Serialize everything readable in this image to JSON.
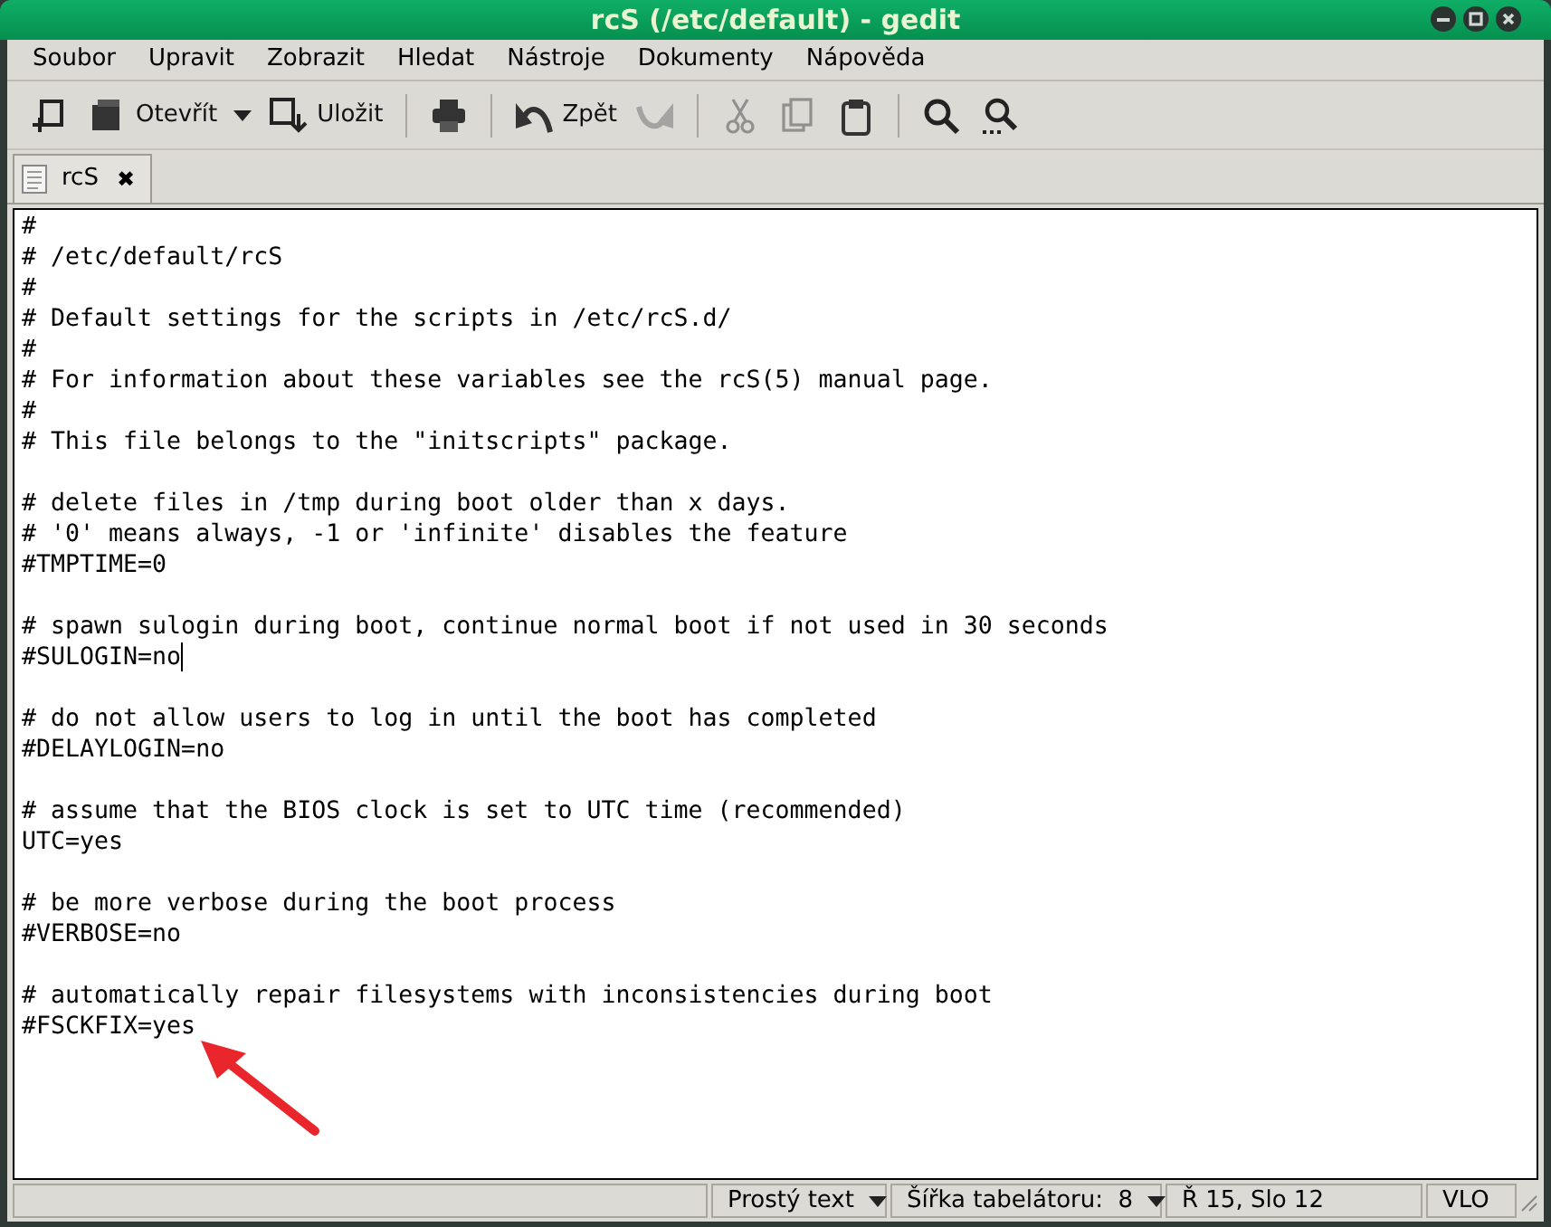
{
  "window": {
    "title": "rcS (/etc/default) - gedit"
  },
  "menu": [
    "Soubor",
    "Upravit",
    "Zobrazit",
    "Hledat",
    "Nástroje",
    "Dokumenty",
    "Nápověda"
  ],
  "toolbar": [
    {
      "kind": "button",
      "disabled": false
    },
    {
      "kind": "button",
      "label": "Otevřít",
      "disabled": false
    },
    {
      "kind": "dropdown",
      "disabled": false
    },
    {
      "kind": "button",
      "label": "Uložit",
      "disabled": false
    },
    {
      "kind": "separator"
    },
    {
      "kind": "button",
      "disabled": false
    },
    {
      "kind": "separator"
    },
    {
      "kind": "button",
      "label": "Zpět",
      "disabled": false
    },
    {
      "kind": "button",
      "disabled": true
    },
    {
      "kind": "separator"
    },
    {
      "kind": "button",
      "disabled": true
    },
    {
      "kind": "button",
      "disabled": true
    },
    {
      "kind": "button",
      "disabled": false
    },
    {
      "kind": "separator"
    },
    {
      "kind": "button",
      "disabled": false
    },
    {
      "kind": "button",
      "disabled": false
    }
  ],
  "tabs": [
    {
      "label": "rcS",
      "selected": true,
      "close": "✖"
    }
  ],
  "editor": {
    "blocks": [
      {
        "lines": [
          {
            "text": "#",
            "cursor": false
          },
          {
            "text": "# /etc/default/rcS",
            "cursor": false
          },
          {
            "text": "#",
            "cursor": false
          },
          {
            "text": "# Default settings for the scripts in /etc/rcS.d/",
            "cursor": false
          },
          {
            "text": "#",
            "cursor": false
          },
          {
            "text": "# For information about these variables see the rcS(5) manual page.",
            "cursor": false
          },
          {
            "text": "#",
            "cursor": false
          },
          {
            "text": "# This file belongs to the \"initscripts\" package.",
            "cursor": false
          }
        ]
      },
      {
        "lines": [
          {
            "text": "# delete files in /tmp during boot older than x days.",
            "cursor": false
          },
          {
            "text": "# '0' means always, -1 or 'infinite' disables the feature",
            "cursor": false
          },
          {
            "text": "#TMPTIME=0",
            "cursor": false
          }
        ]
      },
      {
        "lines": [
          {
            "text": "# spawn sulogin during boot, continue normal boot if not used in 30 seconds",
            "cursor": false
          },
          {
            "text": "#SULOGIN=no",
            "cursor": true
          }
        ]
      },
      {
        "lines": [
          {
            "text": "# do not allow users to log in until the boot has completed",
            "cursor": false
          },
          {
            "text": "#DELAYLOGIN=no",
            "cursor": false
          }
        ]
      },
      {
        "lines": [
          {
            "text": "# assume that the BIOS clock is set to UTC time (recommended)",
            "cursor": false
          },
          {
            "text": "UTC=yes",
            "cursor": false
          }
        ]
      },
      {
        "lines": [
          {
            "text": "# be more verbose during the boot process",
            "cursor": false
          },
          {
            "text": "#VERBOSE=no",
            "cursor": false
          }
        ]
      },
      {
        "lines": [
          {
            "text": "# automatically repair filesystems with inconsistencies during boot",
            "cursor": false
          },
          {
            "text": "#FSCKFIX=yes",
            "cursor": false
          }
        ]
      }
    ]
  },
  "annotation": {
    "kind": "arrow",
    "color": "#e8262b"
  },
  "status_bar": {
    "language": "Prostý text",
    "tab_width": "Šířka tabelátoru:  8",
    "position": "Ř 15, Slo 12",
    "mode": "VLO"
  }
}
